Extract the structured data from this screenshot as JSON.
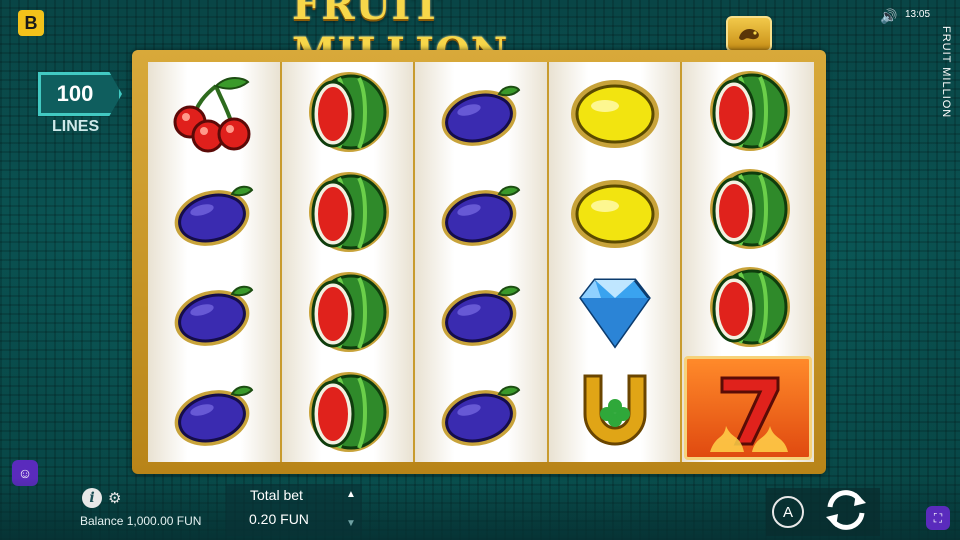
{
  "app": {
    "logo_letter": "B",
    "title": "FRUIT MILLION",
    "clock": "13:05",
    "vertical_title": "FRUIT MILLION"
  },
  "lines": {
    "count": "100",
    "label": "LINES"
  },
  "reels": [
    [
      "cherry",
      "plum",
      "plum",
      "plum"
    ],
    [
      "watermelon",
      "watermelon",
      "watermelon",
      "watermelon"
    ],
    [
      "plum",
      "plum",
      "plum",
      "plum"
    ],
    [
      "lemon",
      "lemon",
      "diamond",
      "horseshoe"
    ],
    [
      "watermelon",
      "watermelon",
      "watermelon",
      "seven"
    ]
  ],
  "footer": {
    "balance_text": "Balance 1,000.00 FUN",
    "total_bet_label": "Total bet",
    "total_bet_value": "0.20 FUN",
    "auto_label": "A"
  },
  "icons": {
    "sound": "speaker-icon",
    "info": "info-icon",
    "settings": "gear-icon",
    "paytable": "chameleon-icon",
    "spin": "spin-arrows-icon",
    "bet_up": "triangle-up-icon",
    "bet_down": "triangle-down-icon"
  },
  "colors": {
    "accent_gold": "#f3c21a",
    "panel_teal": "#0d6d6b",
    "badge_border": "#42c9c2",
    "side_purple": "#5a2bbd"
  }
}
